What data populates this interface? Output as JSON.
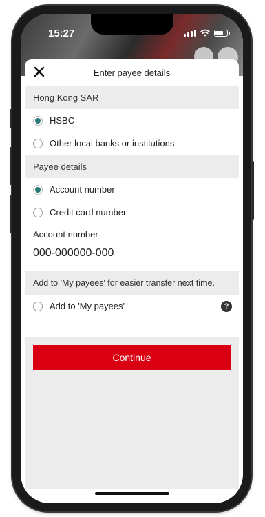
{
  "status_bar": {
    "time": "15:27"
  },
  "header": {
    "title": "Enter payee details",
    "close_icon": "close-icon"
  },
  "bank_section": {
    "title": "Hong Kong SAR",
    "options": [
      {
        "label": "HSBC",
        "checked": true
      },
      {
        "label": "Other local banks or institutions",
        "checked": false
      }
    ]
  },
  "payee_section": {
    "title": "Payee details",
    "options": [
      {
        "label": "Account number",
        "checked": true
      },
      {
        "label": "Credit card number",
        "checked": false
      }
    ],
    "account_field": {
      "label": "Account number",
      "value": "000-000000-000"
    }
  },
  "my_payees": {
    "info": "Add to 'My payees' for easier transfer next time.",
    "checkbox_label": "Add to 'My payees'",
    "checked": false,
    "help_symbol": "?"
  },
  "continue_button": {
    "label": "Continue"
  },
  "colors": {
    "brand_red": "#db0011",
    "radio_selected": "#2a7a78",
    "section_bg": "#ececec"
  }
}
